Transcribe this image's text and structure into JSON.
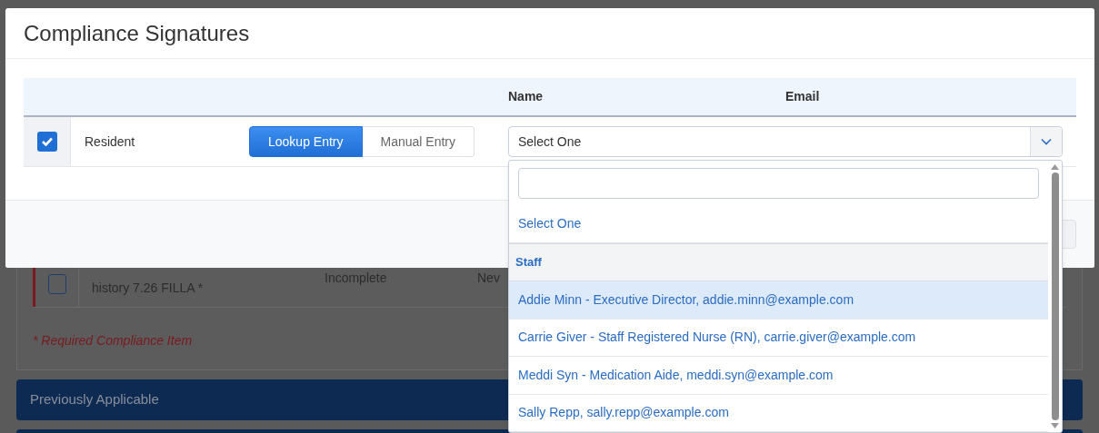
{
  "background": {
    "row": {
      "title_lines": [
        "history 7.26 FILLA *"
      ],
      "status": "Incomplete",
      "column_3": "Nev",
      "required": true,
      "checked": false
    },
    "note": "* Required Compliance Item",
    "sections": [
      "Previously Applicable"
    ]
  },
  "dialog": {
    "title": "Compliance Signatures",
    "table": {
      "columns": [
        "Name",
        "Email"
      ],
      "rows": [
        {
          "checked": true,
          "role": "Resident",
          "modes": [
            {
              "label": "Lookup Entry",
              "selected": true
            },
            {
              "label": "Manual Entry",
              "selected": false
            }
          ],
          "select": {
            "value": "Select One",
            "expanded": true
          }
        }
      ]
    }
  },
  "dropdown": {
    "options": [
      {
        "kind": "option",
        "label": "Select One",
        "highlighted": false
      },
      {
        "kind": "group",
        "label": "Staff"
      },
      {
        "kind": "option",
        "label": "Addie Minn - Executive Director, addie.minn@example.com",
        "highlighted": true
      },
      {
        "kind": "option",
        "label": "Carrie Giver - Staff Registered Nurse (RN), carrie.giver@example.com",
        "highlighted": false
      },
      {
        "kind": "option",
        "label": "Meddi Syn - Medication Aide, meddi.syn@example.com",
        "highlighted": false
      },
      {
        "kind": "option",
        "label": "Sally Repp, sally.repp@example.com",
        "highlighted": false
      }
    ]
  }
}
